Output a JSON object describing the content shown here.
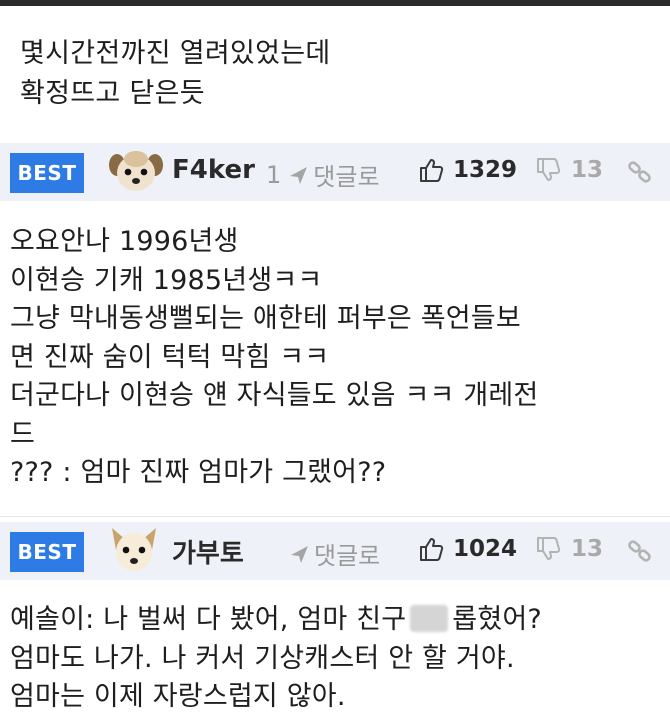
{
  "post": {
    "lines": [
      "몇시간전까진 열려있었는데",
      "확정뜨고 닫은듯"
    ]
  },
  "comments": [
    {
      "badge": "BEST",
      "nickname": "F4ker",
      "reply_count": "1",
      "reply_label": "댓글로",
      "likes": "1329",
      "dislikes": "13",
      "lines": [
        "오요안나 1996년생",
        "이현승 기캐 1985년생ㅋㅋ",
        "그냥 막내동생뻘되는 애한테 퍼부은 폭언들보",
        "면 진짜 숨이 턱턱 막힘 ㅋㅋ",
        "더군다나 이현승 얜 자식들도 있음 ㅋㅋ 개레전",
        "드",
        "??? : 엄마 진짜 엄마가 그랬어??"
      ]
    },
    {
      "badge": "BEST",
      "nickname": "가부토",
      "reply_count": "",
      "reply_label": "댓글로",
      "likes": "1024",
      "dislikes": "13",
      "line1_before": "예솔이: 나 벌써 다 봤어, 엄마 친구",
      "line1_after": "롭혔어?",
      "lines": [
        "엄마도 나가. 나 커서 기상캐스터 안 할 거야.",
        "엄마는 이제 자랑스럽지 않아."
      ]
    }
  ],
  "icons": {
    "reply": "reply-arrow-icon",
    "like": "thumbs-up-icon",
    "dislike": "thumbs-down-icon",
    "link": "link-icon",
    "avatar": "puppy-avatar-icon"
  },
  "colors": {
    "badge": "#2e7be6",
    "head_bg": "#eef1f8",
    "muted": "#9a9a9a"
  }
}
